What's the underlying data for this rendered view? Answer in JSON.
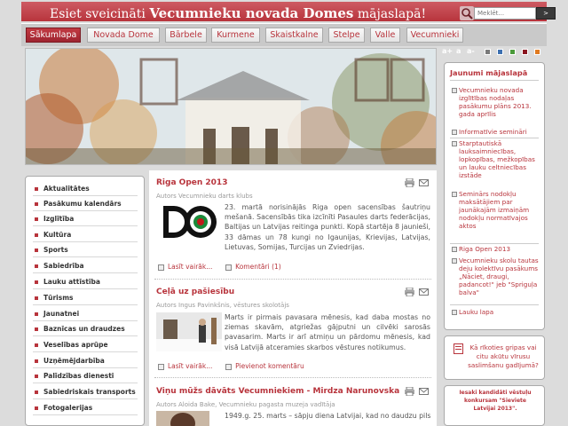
{
  "header": {
    "title_pre": "Esiet sveicināti",
    "title_strong": "Vecumnieku novada Domes",
    "title_post": "mājaslapā!"
  },
  "search": {
    "placeholder": "Meklēt...",
    "button_label": ">"
  },
  "nav": {
    "tabs": [
      {
        "label": "Sākumlapa",
        "active": true
      },
      {
        "label": "Novada Dome"
      },
      {
        "label": "Bārbele"
      },
      {
        "label": "Kurmene"
      },
      {
        "label": "Skaistkalne"
      },
      {
        "label": "Stelpe"
      },
      {
        "label": "Valle"
      },
      {
        "label": "Vecumnieki"
      }
    ]
  },
  "toolbar": {
    "font_up": "a+",
    "font_normal": "a",
    "font_down": "a-",
    "swatches": [
      "#7a7a7a",
      "#3c6fb0",
      "#4a9a3a",
      "#8a1520",
      "#e07a20"
    ]
  },
  "left_menu": {
    "items": [
      "Aktualitātes",
      "Pasākumu kalendārs",
      "Izglītība",
      "Kultūra",
      "Sports",
      "Sabiedrība",
      "Lauku attīstība",
      "Tūrisms",
      "Jaunatnei",
      "Baznīcas un draudzes",
      "Veselības aprūpe",
      "Uzņēmējdarbība",
      "Palīdzības dienesti",
      "Sabiedriskais transports",
      "Fotogalerijas"
    ]
  },
  "articles": [
    {
      "title": "Riga Open 2013",
      "meta": "Autors Vecumnieku darts klubs",
      "text": "23. martā norisinājās Riga open sacensības šautriņu mešanā. Sacensībās tika izcīnīti Pasaules darts federācijas, Baltijas un Latvijas reitinga punkti. Kopā startēja 8 jaunieši, 33 dāmas un 78 kungi no Igaunijas, Krievijas, Latvijas, Lietuvas, Somijas, Turcijas un Zviedrijas.",
      "read_more": "Lasīt vairāk...",
      "comments": "Komentāri (1)",
      "logo_text": "DO"
    },
    {
      "title": "Ceļā uz pašiesību",
      "meta": "Autors Ingus Pavinkšnis, vēstures skolotājs",
      "text": "Marts ir pirmais pavasara mēnesis, kad daba mostas no ziemas skavām, atgriežas gājputni un cilvēki sarosās pavasarim. Marts ir arī atmiņu un pārdomu mēnesis, kad visā Latvijā atceramies skarbos vēstures notikumus.",
      "read_more": "Lasīt vairāk...",
      "comments": "Pievienot komentāru"
    },
    {
      "title": "Viņu mūžs dāvāts Vecumniekiem - Mirdza Narunovska",
      "meta": "Autors Aloida Bake, Vecumnieku pagasta muzeja vadītāja",
      "text": "1949.g. 25. marts – sāpju diena Latvijai, kad no daudzu pilsētu un"
    }
  ],
  "right_sidebar": {
    "heading": "Jaunumi mājaslapā",
    "items": [
      "Vecumnieku novada izglītības nodaļas pasākumu plāns 2013. gada aprīlis",
      "Informatīvie semināri",
      "Starptautiskā lauksaimniecības, lopkopības, mežkopības un lauku celtniecības izstāde",
      "Seminārs nodokļu maksātājiem par jaunākajām izmaiņām nodokļu normatīvajos aktos",
      "Riga Open 2013",
      "Vecumnieku skolu tautas deju kolektīvu pasākums „Nāciet, draugi, padancot!\" jeb \"Spriguļa balva\"",
      "Lauku lapa"
    ]
  },
  "promo": {
    "text": "Kā rīkoties gripas vai citu akūtu vīrusu saslimšanu gadījumā?"
  },
  "contest": {
    "text": "Iesaki kandidāti vēstuļu konkursam \"Sieviete Latvijai 2013\"."
  },
  "colors": {
    "accent": "#b8343c",
    "accent_dark": "#9e2430",
    "page_bg": "#dcdcdc"
  }
}
